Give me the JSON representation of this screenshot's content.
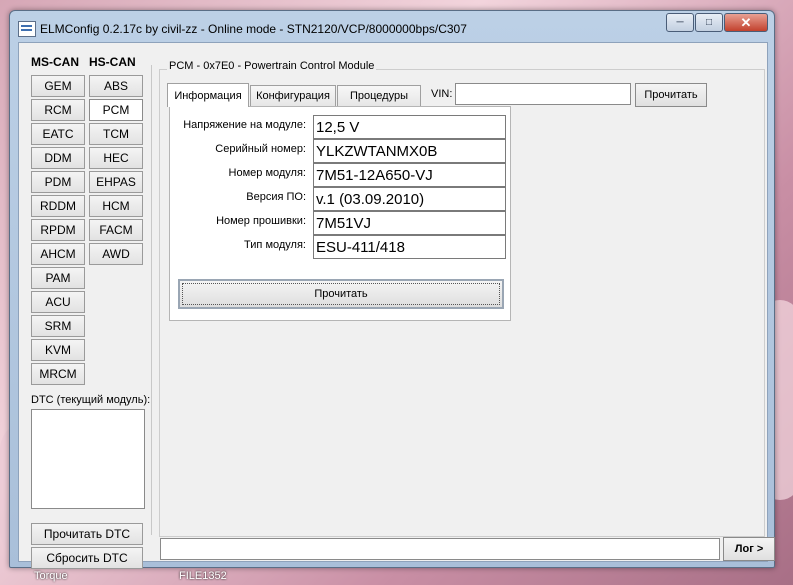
{
  "window": {
    "title": "ELMConfig 0.2.17c by civil-zz - Online mode - STN2120/VCP/8000000bps/C307"
  },
  "left": {
    "ms_can_header": "MS-CAN",
    "hs_can_header": "HS-CAN",
    "ms_can": [
      "GEM",
      "RCM",
      "EATC",
      "DDM",
      "PDM",
      "RDDM",
      "RPDM",
      "AHCM",
      "PAM",
      "ACU",
      "SRM",
      "KVM",
      "MRCM"
    ],
    "hs_can": [
      "ABS",
      "PCM",
      "TCM",
      "HEC",
      "EHPAS",
      "HCM",
      "FACM",
      "AWD"
    ],
    "selected_module": "PCM",
    "dtc_label": "DTC (текущий модуль):",
    "read_dtc": "Прочитать DTC",
    "clear_dtc": "Сбросить DTC"
  },
  "main": {
    "group_title": "PCM - 0x7E0 - Powertrain Control Module",
    "tabs": [
      "Информация",
      "Конфигурация",
      "Процедуры"
    ],
    "active_tab": "Информация",
    "vin_label": "VIN:",
    "vin_value": "",
    "vin_read": "Прочитать",
    "fields": [
      {
        "label": "Напряжение на модуле:",
        "value": "12,5 V"
      },
      {
        "label": "Серийный номер:",
        "value": "YLKZWTANMX0B"
      },
      {
        "label": "Номер модуля:",
        "value": "7M51-12A650-VJ"
      },
      {
        "label": "Версия ПО:",
        "value": "v.1 (03.09.2010)"
      },
      {
        "label": "Номер прошивки:",
        "value": "7M51VJ"
      },
      {
        "label": "Тип модуля:",
        "value": "ESU-411/418"
      }
    ],
    "read_button": "Прочитать"
  },
  "status": {
    "log_button": "Лог >"
  },
  "taskbar": {
    "items": [
      "Torque",
      "FILE1352"
    ]
  },
  "colors": {
    "titlebar": "#bcd0e6",
    "client_bg": "#f0f0f0",
    "close_button": "#c2412d"
  },
  "icons": {
    "app": "app-window-icon",
    "minimize": "minimize-icon",
    "maximize": "maximize-icon",
    "close": "close-icon"
  }
}
